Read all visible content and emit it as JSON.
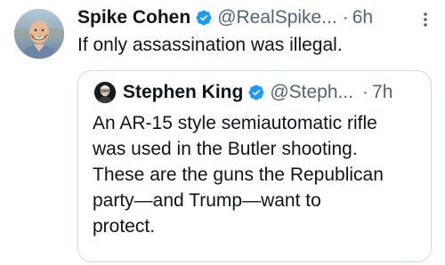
{
  "tweet": {
    "author_name": "Spike Cohen",
    "handle": "@RealSpike...",
    "separator": "·",
    "time": "6h",
    "text": "If only assassination was illegal.",
    "verified_icon": "verified-badge-icon",
    "more_icon": "more-options-icon"
  },
  "quoted_tweet": {
    "author_name": "Stephen King",
    "handle": "@Steph...",
    "separator": "·",
    "time": "7h",
    "text_lines": [
      "An AR-15 style semiautomatic rifle",
      "was used in the Butler shooting.",
      "These are the guns the Republican",
      "party—and Trump—want to",
      "protect."
    ],
    "verified_icon": "verified-badge-icon"
  },
  "colors": {
    "text_primary": "#0f1419",
    "text_secondary": "#536471",
    "verified_blue": "#1d9bf0",
    "border": "#cfd9de"
  }
}
